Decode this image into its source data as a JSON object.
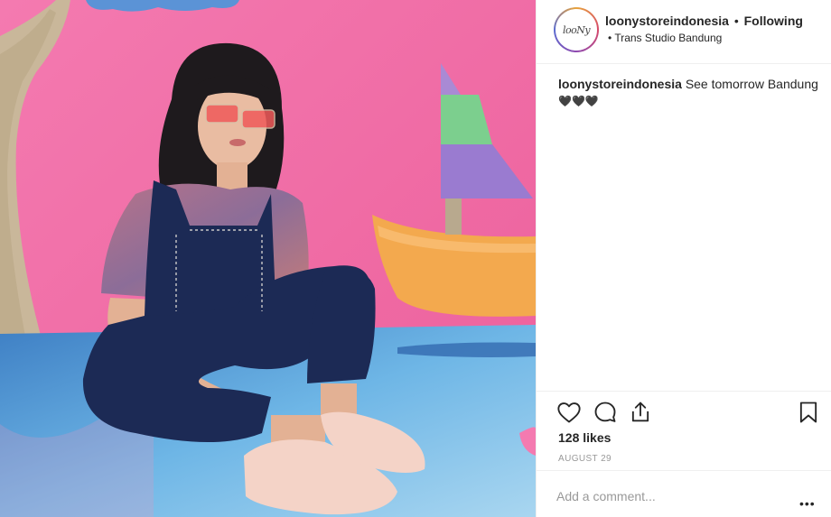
{
  "post": {
    "username": "loonystoreindonesia",
    "separator": "•",
    "follow_status": "Following",
    "location_bullet": "•",
    "location": "Trans Studio Bandung",
    "avatar_logo": "looNy",
    "caption_username": "loonystoreindonesia",
    "caption_text": "See tomorrow Bandung",
    "caption_hearts": "🖤🖤🖤",
    "likes": "128 likes",
    "date": "AUGUST 29",
    "comment_placeholder": "Add a comment...",
    "more_label": "•••"
  },
  "colors": {
    "background_pink": "#f06aa4",
    "water_blue": "#5aa6d9",
    "boat_orange": "#f3a94e",
    "text_dark": "#262626",
    "text_muted": "#999999",
    "divider": "#efefef"
  },
  "icons": [
    "heart-icon",
    "comment-icon",
    "share-icon",
    "bookmark-icon"
  ]
}
